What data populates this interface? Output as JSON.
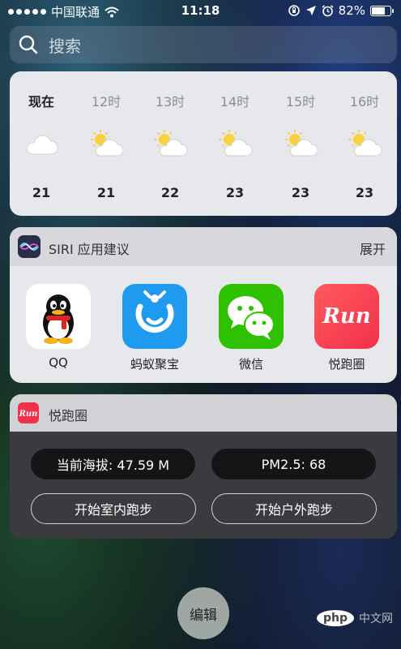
{
  "status_bar": {
    "carrier": "中国联通",
    "time": "11:18",
    "battery_percent": "82%",
    "battery_level": 0.82
  },
  "search": {
    "placeholder": "搜索"
  },
  "weather": {
    "hours": [
      {
        "label": "现在",
        "icon": "cloud-icon",
        "temp": "21"
      },
      {
        "label": "12时",
        "icon": "partly-sunny-icon",
        "temp": "21"
      },
      {
        "label": "13时",
        "icon": "partly-sunny-icon",
        "temp": "22"
      },
      {
        "label": "14时",
        "icon": "partly-sunny-icon",
        "temp": "23"
      },
      {
        "label": "15时",
        "icon": "partly-sunny-icon",
        "temp": "23"
      },
      {
        "label": "16时",
        "icon": "partly-sunny-icon",
        "temp": "23"
      }
    ]
  },
  "siri": {
    "title": "SIRI 应用建议",
    "expand_label": "展开",
    "apps": [
      {
        "name": "QQ",
        "icon": "qq-icon"
      },
      {
        "name": "蚂蚁聚宝",
        "icon": "antfortune-icon"
      },
      {
        "name": "微信",
        "icon": "wechat-icon"
      },
      {
        "name": "悦跑圈",
        "icon": "joyrun-icon"
      }
    ]
  },
  "joyrun": {
    "title": "悦跑圈",
    "icon_text": "Run",
    "altitude": "当前海拔: 47.59 M",
    "pm25": "PM2.5: 68",
    "indoor_button": "开始室内跑步",
    "outdoor_button": "开始户外跑步"
  },
  "edit_button": "编辑",
  "watermark": {
    "logo": "php",
    "text": "中文网"
  },
  "colors": {
    "accent_red": "#f23a4e",
    "wechat_green": "#2dc100",
    "antfortune_blue": "#1e9bf0"
  }
}
